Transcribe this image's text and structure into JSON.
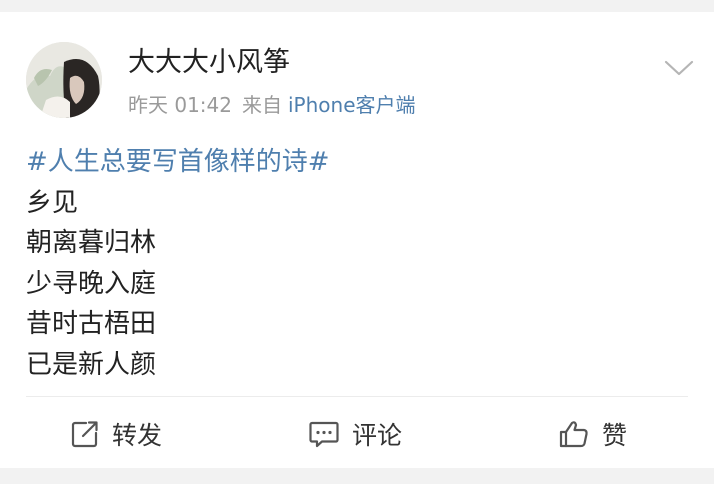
{
  "post": {
    "username": "大大大小风筝",
    "time": "昨天 01:42",
    "source_prefix": "来自",
    "source_device": "iPhone客户端",
    "topic": "#人生总要写首像样的诗#",
    "lines": [
      "乡见",
      "朝离暮归林",
      "少寻晚入庭",
      "昔时古梧田",
      "已是新人颜"
    ]
  },
  "actions": {
    "forward_label": "转发",
    "comment_label": "评论",
    "like_label": "赞"
  },
  "icons": {
    "chevron": "chevron-down-icon",
    "forward": "share-icon",
    "comment": "comment-icon",
    "like": "thumbs-up-icon"
  },
  "colors": {
    "link": "#4f7fae",
    "text": "#222222",
    "meta": "#9a9a9a",
    "background": "#f2f2f2"
  }
}
